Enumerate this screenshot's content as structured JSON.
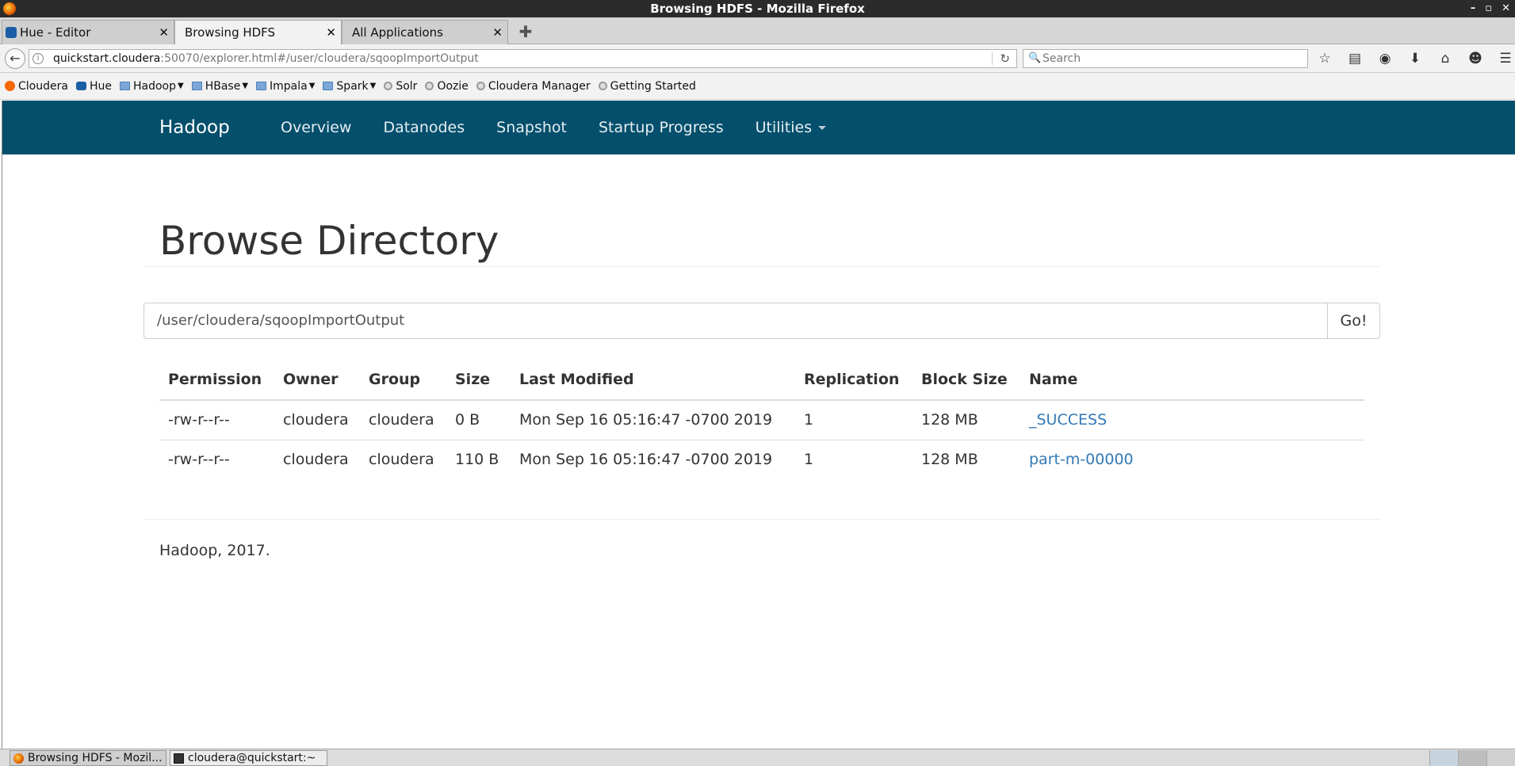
{
  "window": {
    "title": "Browsing HDFS - Mozilla Firefox",
    "controls": [
      "–",
      "▫",
      "✕"
    ]
  },
  "tabs": [
    {
      "label": "Hue - Editor",
      "active": false,
      "icon": "hue-icon"
    },
    {
      "label": "Browsing HDFS",
      "active": true,
      "icon": "none"
    },
    {
      "label": "All Applications",
      "active": false,
      "icon": "none"
    }
  ],
  "newtab_glyph": "✚",
  "navbar": {
    "url_host": "quickstart.cloudera",
    "url_rest": ":50070/explorer.html#/user/cloudera/sqoopImportOutput",
    "search_placeholder": "Search"
  },
  "bookmarks": [
    {
      "label": "Cloudera",
      "icon": "cloudera-icon",
      "dropdown": false
    },
    {
      "label": "Hue",
      "icon": "hue-icon",
      "dropdown": false
    },
    {
      "label": "Hadoop",
      "icon": "folder-icon",
      "dropdown": true
    },
    {
      "label": "HBase",
      "icon": "folder-icon",
      "dropdown": true
    },
    {
      "label": "Impala",
      "icon": "folder-icon",
      "dropdown": true
    },
    {
      "label": "Spark",
      "icon": "folder-icon",
      "dropdown": true
    },
    {
      "label": "Solr",
      "icon": "globe-icon",
      "dropdown": false
    },
    {
      "label": "Oozie",
      "icon": "globe-icon",
      "dropdown": false
    },
    {
      "label": "Cloudera Manager",
      "icon": "globe-icon",
      "dropdown": false
    },
    {
      "label": "Getting Started",
      "icon": "globe-icon",
      "dropdown": false
    }
  ],
  "hadoop_nav": {
    "brand": "Hadoop",
    "links": [
      "Overview",
      "Datanodes",
      "Snapshot",
      "Startup Progress",
      "Utilities"
    ],
    "bg_color": "#034f6c"
  },
  "page": {
    "heading": "Browse Directory",
    "directory_value": "/user/cloudera/sqoopImportOutput",
    "go_label": "Go!",
    "columns": [
      "Permission",
      "Owner",
      "Group",
      "Size",
      "Last Modified",
      "Replication",
      "Block Size",
      "Name"
    ],
    "rows": [
      [
        "-rw-r--r--",
        "cloudera",
        "cloudera",
        "0 B",
        "Mon Sep 16 05:16:47 -0700 2019",
        "1",
        "128 MB",
        "_SUCCESS"
      ],
      [
        "-rw-r--r--",
        "cloudera",
        "cloudera",
        "110 B",
        "Mon Sep 16 05:16:47 -0700 2019",
        "1",
        "128 MB",
        "part-m-00000"
      ]
    ],
    "footer": "Hadoop, 2017.",
    "link_color": "#337ab7"
  },
  "taskbar": [
    {
      "label": "Browsing HDFS - Mozil...",
      "icon": "firefox-icon",
      "active": true
    },
    {
      "label": "cloudera@quickstart:~",
      "icon": "terminal-icon",
      "active": false
    }
  ]
}
